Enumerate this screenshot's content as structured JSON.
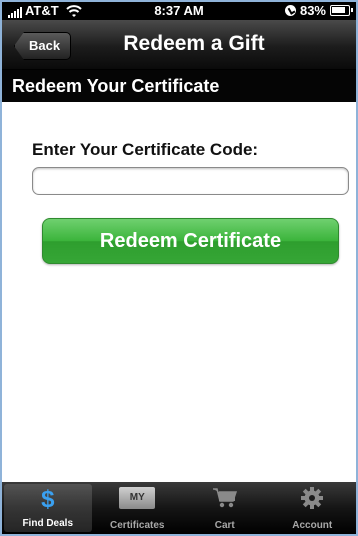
{
  "status_bar": {
    "carrier": "AT&T",
    "time": "8:37 AM",
    "battery": "83%"
  },
  "nav": {
    "back_label": "Back",
    "title": "Redeem a Gift"
  },
  "section": {
    "title": "Redeem Your Certificate"
  },
  "form": {
    "label": "Enter Your Certificate Code:",
    "code_value": "",
    "submit_label": "Redeem Certificate"
  },
  "tabs": [
    {
      "label": "Find Deals",
      "icon": "dollar-icon",
      "active": true
    },
    {
      "label": "Certificates",
      "icon": "my-certificates-icon",
      "icon_text": "MY",
      "active": false
    },
    {
      "label": "Cart",
      "icon": "cart-icon",
      "active": false
    },
    {
      "label": "Account",
      "icon": "gear-icon",
      "active": false
    }
  ],
  "colors": {
    "accent_green": "#3bb43b",
    "tab_active_icon": "#3aa0f0",
    "frame": "#8fb3d9"
  }
}
